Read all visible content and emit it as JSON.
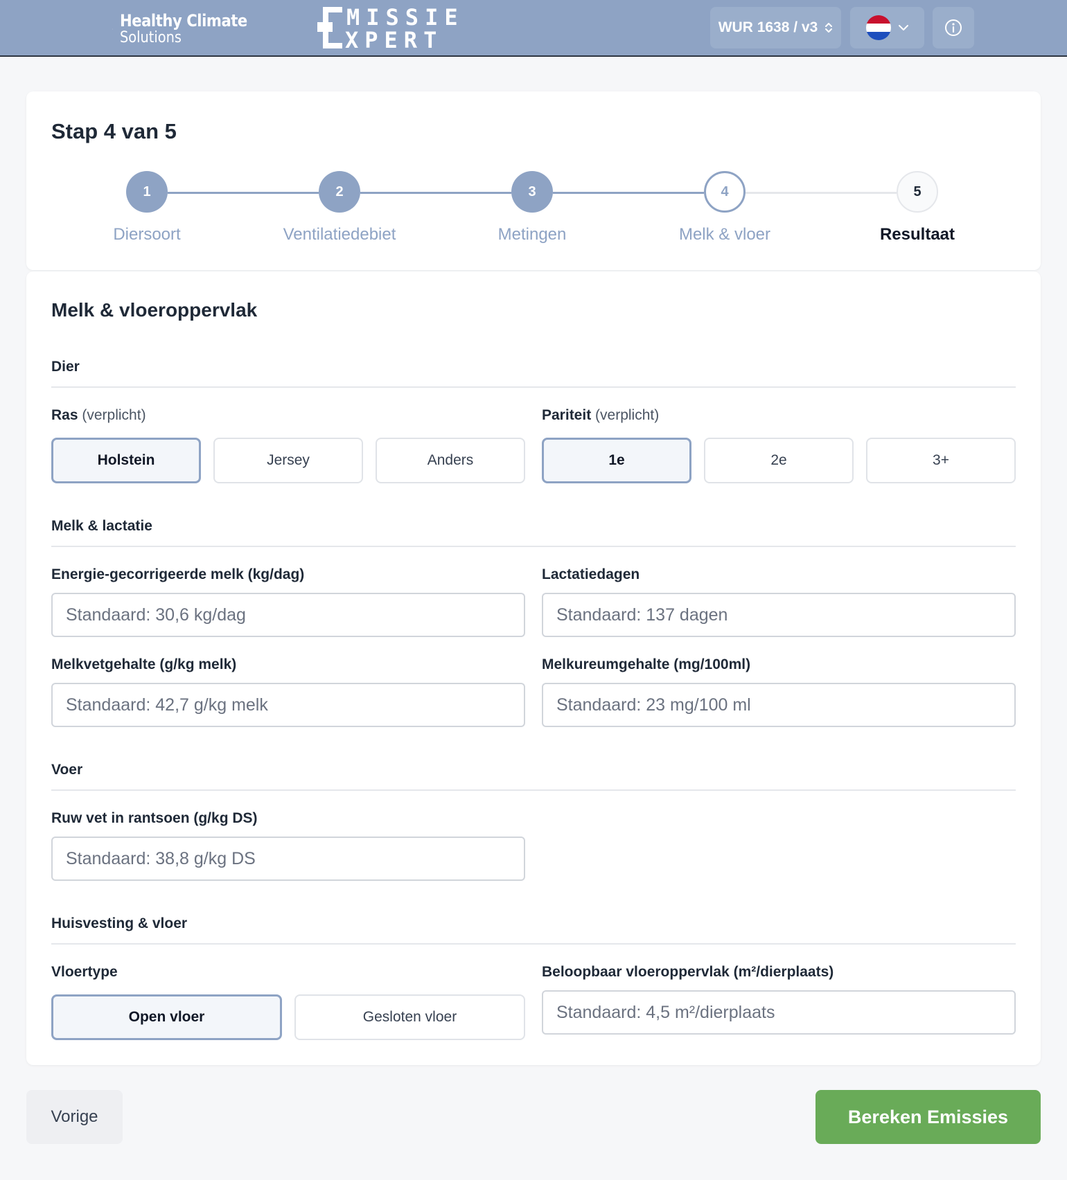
{
  "header": {
    "brand_hcs_line1": "Healthy Climate",
    "brand_hcs_line2": "Solutions",
    "brand_em_line1": "MISSIE",
    "brand_em_line2": "XPERT",
    "version_label": "WUR 1638 / v3",
    "language": "nl",
    "accent_color": "#8ea3c4"
  },
  "stepper": {
    "title": "Stap 4 van 5",
    "steps": [
      {
        "number": "1",
        "label": "Diersoort",
        "state": "done"
      },
      {
        "number": "2",
        "label": "Ventilatiedebiet",
        "state": "done"
      },
      {
        "number": "3",
        "label": "Metingen",
        "state": "done"
      },
      {
        "number": "4",
        "label": "Melk & vloer",
        "state": "current"
      },
      {
        "number": "5",
        "label": "Resultaat",
        "state": "todo"
      }
    ]
  },
  "form": {
    "title": "Melk & vloeroppervlak",
    "sections": {
      "dier": "Dier",
      "melk": "Melk & lactatie",
      "voer": "Voer",
      "huisvesting": "Huisvesting & vloer"
    },
    "ras": {
      "label": "Ras",
      "required": "(verplicht)",
      "options": [
        "Holstein",
        "Jersey",
        "Anders"
      ],
      "selected": "Holstein"
    },
    "pariteit": {
      "label": "Pariteit",
      "required": "(verplicht)",
      "options": [
        "1e",
        "2e",
        "3+"
      ],
      "selected": "1e"
    },
    "ecm": {
      "label": "Energie-gecorrigeerde melk (kg/dag)",
      "value": "",
      "placeholder": "Standaard: 30,6 kg/dag"
    },
    "lactatiedagen": {
      "label": "Lactatiedagen",
      "value": "",
      "placeholder": "Standaard: 137 dagen"
    },
    "melkvet": {
      "label": "Melkvetgehalte (g/kg melk)",
      "value": "",
      "placeholder": "Standaard: 42,7 g/kg melk"
    },
    "melkureum": {
      "label": "Melkureumgehalte (mg/100ml)",
      "value": "",
      "placeholder": "Standaard: 23 mg/100 ml"
    },
    "ruwvet": {
      "label": "Ruw vet in rantsoen (g/kg DS)",
      "value": "",
      "placeholder": "Standaard: 38,8 g/kg DS"
    },
    "vloertype": {
      "label": "Vloertype",
      "options": [
        "Open vloer",
        "Gesloten vloer"
      ],
      "selected": "Open vloer"
    },
    "vloeroppervlak": {
      "label": "Beloopbaar vloeroppervlak (m²/dierplaats)",
      "value": "",
      "placeholder": "Standaard: 4,5 m²/dierplaats"
    }
  },
  "footer": {
    "prev_label": "Vorige",
    "calc_label": "Bereken Emissies",
    "calc_color": "#69ab58"
  }
}
